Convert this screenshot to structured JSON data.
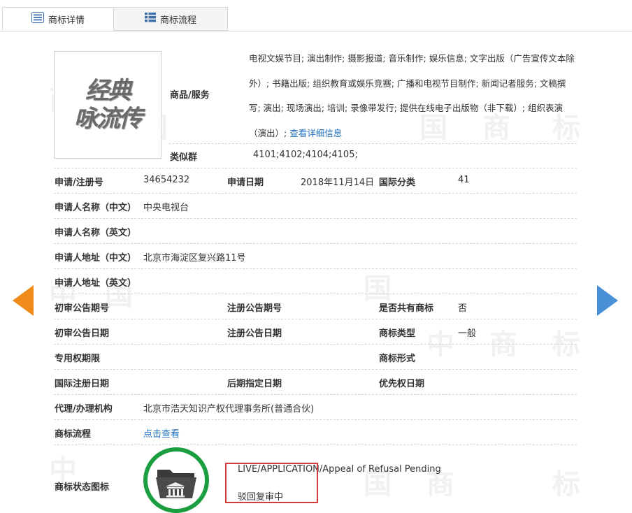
{
  "tabs": {
    "detail_label": "商标详情",
    "process_label": "商标流程"
  },
  "logo": {
    "line1": "经典",
    "line2": "咏流传"
  },
  "goods": {
    "label": "商品/服务",
    "text": "电视文娱节目; 演出制作; 摄影报道; 音乐制作; 娱乐信息; 文字出版（广告宣传文本除外）; 书籍出版; 组织教育或娱乐竞赛; 广播和电视节目制作; 新闻记者服务; 文稿撰写; 演出; 现场演出; 培训; 录像带发行; 提供在线电子出版物（非下载）; 组织表演（演出）; ",
    "more_link": "查看详细信息"
  },
  "similar_group": {
    "label": "类似群",
    "value": "4101;4102;4104;4105;"
  },
  "fields": {
    "reg_no_label": "申请/注册号",
    "reg_no": "34654232",
    "apply_date_label": "申请日期",
    "apply_date": "2018年11月14日",
    "intl_class_label": "国际分类",
    "intl_class": "41",
    "applicant_cn_label": "申请人名称（中文）",
    "applicant_cn": "中央电视台",
    "applicant_en_label": "申请人名称（英文）",
    "address_cn_label": "申请人地址（中文）",
    "address_cn": "北京市海淀区复兴路11号",
    "address_en_label": "申请人地址（英文）",
    "prelim_no_label": "初审公告期号",
    "reg_pub_no_label": "注册公告期号",
    "shared_label": "是否共有商标",
    "shared": "否",
    "prelim_date_label": "初审公告日期",
    "reg_pub_date_label": "注册公告日期",
    "mark_type_label": "商标类型",
    "mark_type": "一般",
    "exclusive_label": "专用权期限",
    "mark_form_label": "商标形式",
    "intl_reg_date_label": "国际注册日期",
    "later_date_label": "后期指定日期",
    "priority_date_label": "优先权日期",
    "agent_label": "代理/办理机构",
    "agent": "北京市浩天知识产权代理事务所(普通合伙)",
    "process_label": "商标流程",
    "process_link": "点击查看",
    "status_icon_label": "商标状态图标"
  },
  "status": {
    "en": "LIVE/APPLICATION/Appeal of Refusal Pending",
    "cn": "驳回复审中"
  },
  "colors": {
    "link": "#1e6fc0",
    "prev_arrow": "#f08a1a",
    "next_arrow": "#4a90d9",
    "status_ring": "#1a9e3f",
    "highlight_box": "#d63a3a"
  },
  "icons": {
    "detail_tab": "list-icon",
    "process_tab": "grid-icon",
    "prev": "arrow-left-icon",
    "next": "arrow-right-icon",
    "status": "folder-bank-icon"
  }
}
